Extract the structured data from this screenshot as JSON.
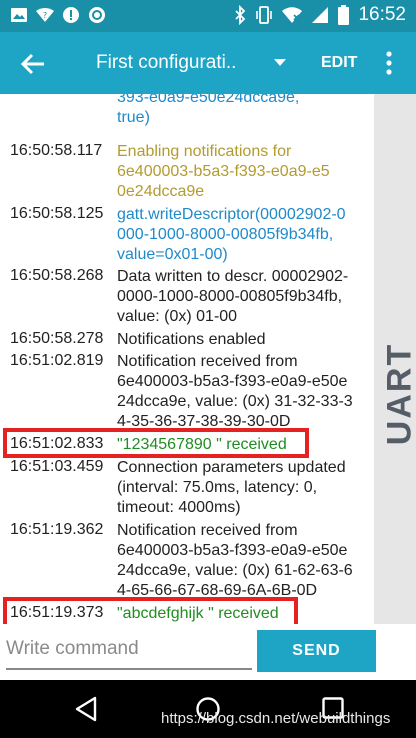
{
  "status_bar": {
    "time": "16:52",
    "left_icons": [
      "image-icon",
      "wifi-question-icon",
      "alert-icon",
      "circle-app-icon"
    ],
    "right_icons": [
      "bluetooth-icon",
      "vibrate-icon",
      "wifi-icon",
      "signal-icon",
      "battery-icon"
    ]
  },
  "app_bar": {
    "title": "First configurati..",
    "edit_label": "EDIT"
  },
  "side_tab": {
    "label": "UART"
  },
  "log": [
    {
      "time": "",
      "message": "393-e0a9-e50e24dcca9e,\ntrue)",
      "color": "blue"
    },
    {
      "time": "16:50:58.117",
      "message": "Enabling notifications for\n6e400003-b5a3-f393-e0a9-e5\n0e24dcca9e",
      "color": "olive"
    },
    {
      "time": "16:50:58.125",
      "message": "gatt.writeDescriptor(00002902-0\n000-1000-8000-00805f9b34fb,\nvalue=0x01-00)",
      "color": "blue"
    },
    {
      "time": "16:50:58.268",
      "message": "Data written to descr. 00002902-\n0000-1000-8000-00805f9b34fb,\nvalue: (0x) 01-00",
      "color": "black"
    },
    {
      "time": "16:50:58.278",
      "message": "Notifications enabled",
      "color": "black"
    },
    {
      "time": "16:51:02.819",
      "message": "Notification received from\n6e400003-b5a3-f393-e0a9-e50e\n24dcca9e, value: (0x) 31-32-33-3\n4-35-36-37-38-39-30-0D",
      "color": "black"
    },
    {
      "time": "16:51:02.833",
      "message": "\"1234567890 \" received",
      "color": "green"
    },
    {
      "time": "16:51:03.459",
      "message": "Connection parameters updated\n(interval: 75.0ms, latency: 0,\ntimeout: 4000ms)",
      "color": "black"
    },
    {
      "time": "16:51:19.362",
      "message": "Notification received from\n6e400003-b5a3-f393-e0a9-e50e\n24dcca9e, value: (0x) 61-62-63-6\n4-65-66-67-68-69-6A-6B-0D",
      "color": "black"
    },
    {
      "time": "16:51:19.373",
      "message": "\"abcdefghijk \" received",
      "color": "green"
    }
  ],
  "command": {
    "placeholder": "Write command",
    "value": "",
    "send_label": "SEND"
  },
  "watermark": "https://blog.csdn.net/webuildthings",
  "colors": {
    "status_bar": "#1a8fa8",
    "app_bar": "#1ea5c6",
    "highlight_box": "#e52222",
    "log_blue": "#1f8ac9",
    "log_olive": "#b39b2d",
    "log_green": "#218c21"
  }
}
